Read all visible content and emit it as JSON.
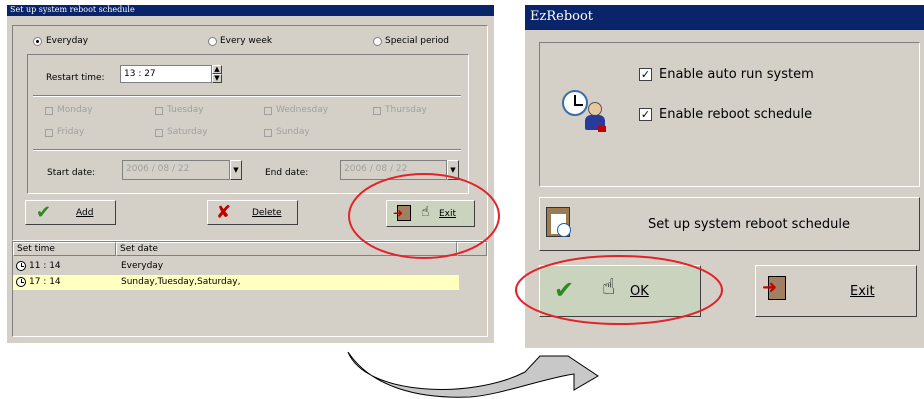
{
  "schedule_window": {
    "title": "Set up system reboot schedule",
    "period_options": [
      {
        "label": "Everyday",
        "selected": true
      },
      {
        "label": "Every week",
        "selected": false
      },
      {
        "label": "Special period",
        "selected": false
      }
    ],
    "restart_time_label": "Restart time:",
    "restart_time_value": "13 : 27",
    "weekdays": [
      "Monday",
      "Tuesday",
      "Wednesday",
      "Thursday",
      "Friday",
      "Saturday",
      "Sunday"
    ],
    "start_date_label": "Start date:",
    "start_date_value": "2006 / 08 / 22",
    "end_date_label": "End date:",
    "end_date_value": "2006 / 08 / 22",
    "buttons": {
      "add": "Add",
      "delete": "Delete",
      "exit": "Exit"
    },
    "table": {
      "columns": [
        "Set time",
        "Set date"
      ],
      "rows": [
        {
          "time": "11 : 14",
          "date": "Everyday",
          "highlighted": false
        },
        {
          "time": "17 : 14",
          "date": "Sunday,Tuesday,Saturday,",
          "highlighted": true
        }
      ]
    }
  },
  "main_window": {
    "title": "EzReboot",
    "enable_auto_run": "Enable auto run system",
    "enable_reboot_schedule": "Enable reboot schedule",
    "setup_button": "Set up system reboot schedule",
    "ok_button": "OK",
    "exit_button": "Exit"
  },
  "icons": [
    "check-icon",
    "cross-icon",
    "exit-door-icon",
    "hand-pointer-icon",
    "clock-icon",
    "clipboard-clock-icon",
    "clock-user-icon",
    "curved-arrow-icon"
  ],
  "colors": {
    "titlebar": "#0a246a",
    "window": "#d4d0c8",
    "highlight_annotation": "#e0242a",
    "row_highlight": "#ffffc0"
  }
}
